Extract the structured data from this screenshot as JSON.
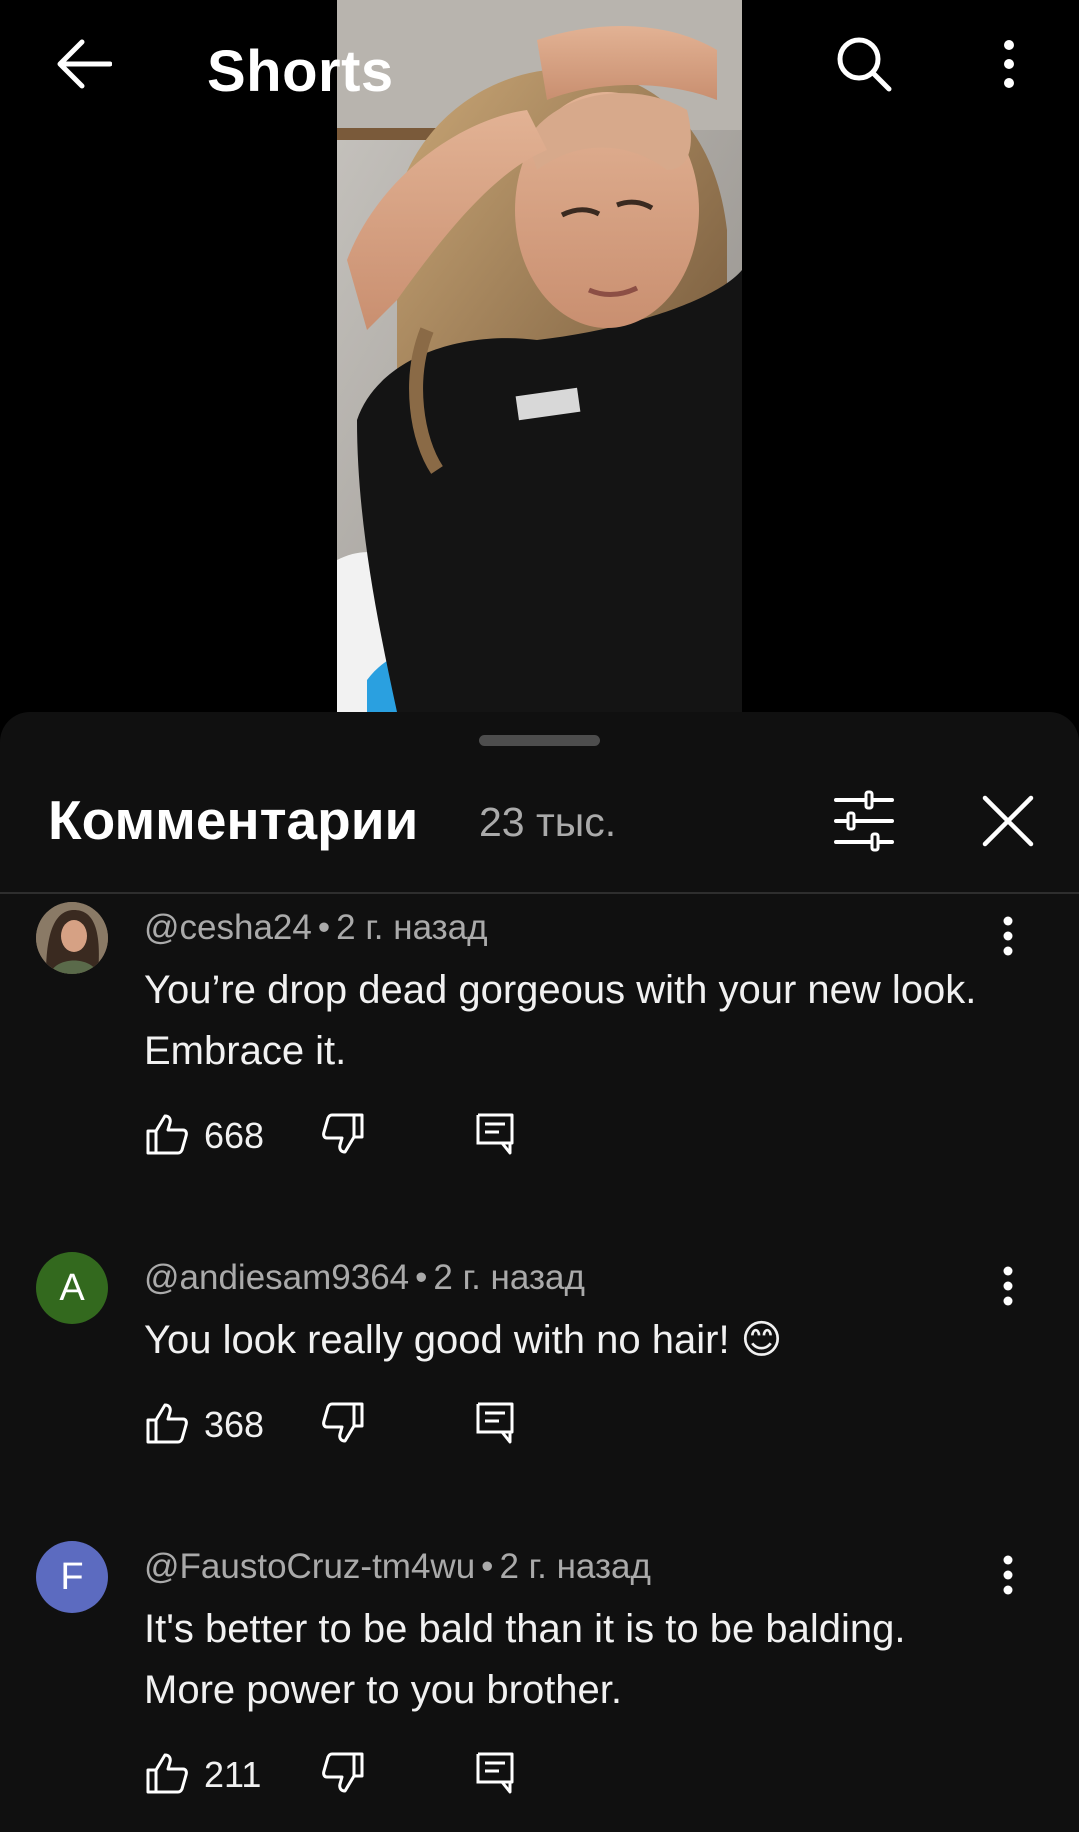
{
  "header": {
    "title": "Shorts",
    "back_icon": "arrow-left-icon",
    "search_icon": "search-icon",
    "more_icon": "more-vert-icon"
  },
  "comments_panel": {
    "title": "Комментарии",
    "count": "23 тыс.",
    "filter_icon": "sliders-icon",
    "close_icon": "close-icon"
  },
  "comments": [
    {
      "author": "@cesha24",
      "time": "2 г. назад",
      "text": "You’re drop dead gorgeous with your new look. Embrace it.",
      "likes": "668",
      "avatar_letter": "",
      "avatar_color": "#6b5a4a"
    },
    {
      "author": "@andiesam9364",
      "time": "2 г. назад",
      "text": "You look really good with no hair! 😊",
      "likes": "368",
      "avatar_letter": "A",
      "avatar_color": "#33691e"
    },
    {
      "author": "@FaustoCruz-tm4wu",
      "time": "2 г. назад",
      "text": "It's better to be bald than it is to be balding. More power to you brother.",
      "likes": "211",
      "avatar_letter": "F",
      "avatar_color": "#5c6bc0"
    }
  ]
}
